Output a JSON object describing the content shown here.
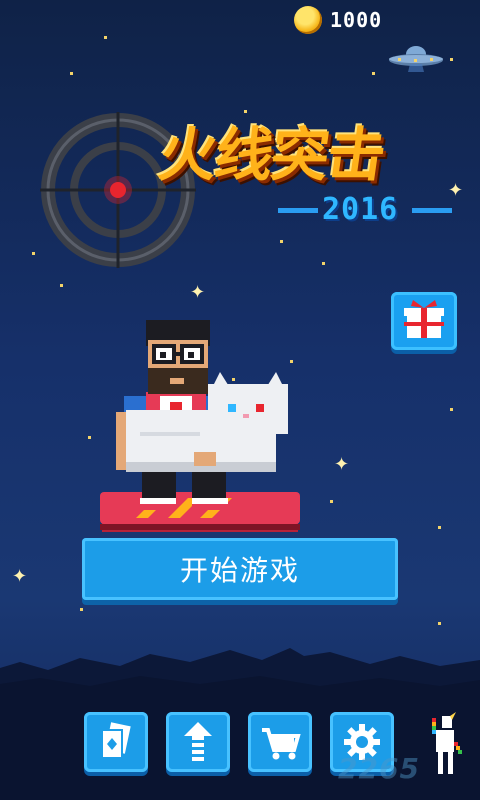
{
  "hud": {
    "coins": "1000",
    "coin_icon": "coin-icon"
  },
  "title": {
    "main": "火线突击",
    "year": "2016"
  },
  "menu": {
    "start_label": "开始游戏"
  },
  "bottom_bar": [
    {
      "name": "cards-button",
      "icon": "cards-icon"
    },
    {
      "name": "upgrade-button",
      "icon": "upgrade-arrow-icon"
    },
    {
      "name": "shop-button",
      "icon": "cart-icon"
    },
    {
      "name": "settings-button",
      "icon": "gear-icon"
    }
  ],
  "side_buttons": {
    "gift_icon": "gift-icon"
  },
  "decor": {
    "characters": [
      "bearded-hero-with-cat",
      "hoverboard",
      "unicorn-mascot",
      "ufo"
    ],
    "watermark": "2265"
  },
  "colors": {
    "background_top": "#0f2247",
    "background_bottom": "#13275a",
    "button_blue": "#1c9de8",
    "title_orange": "#ffb21a",
    "year_blue": "#2fb7ff",
    "hoverboard_red": "#e63a56"
  }
}
